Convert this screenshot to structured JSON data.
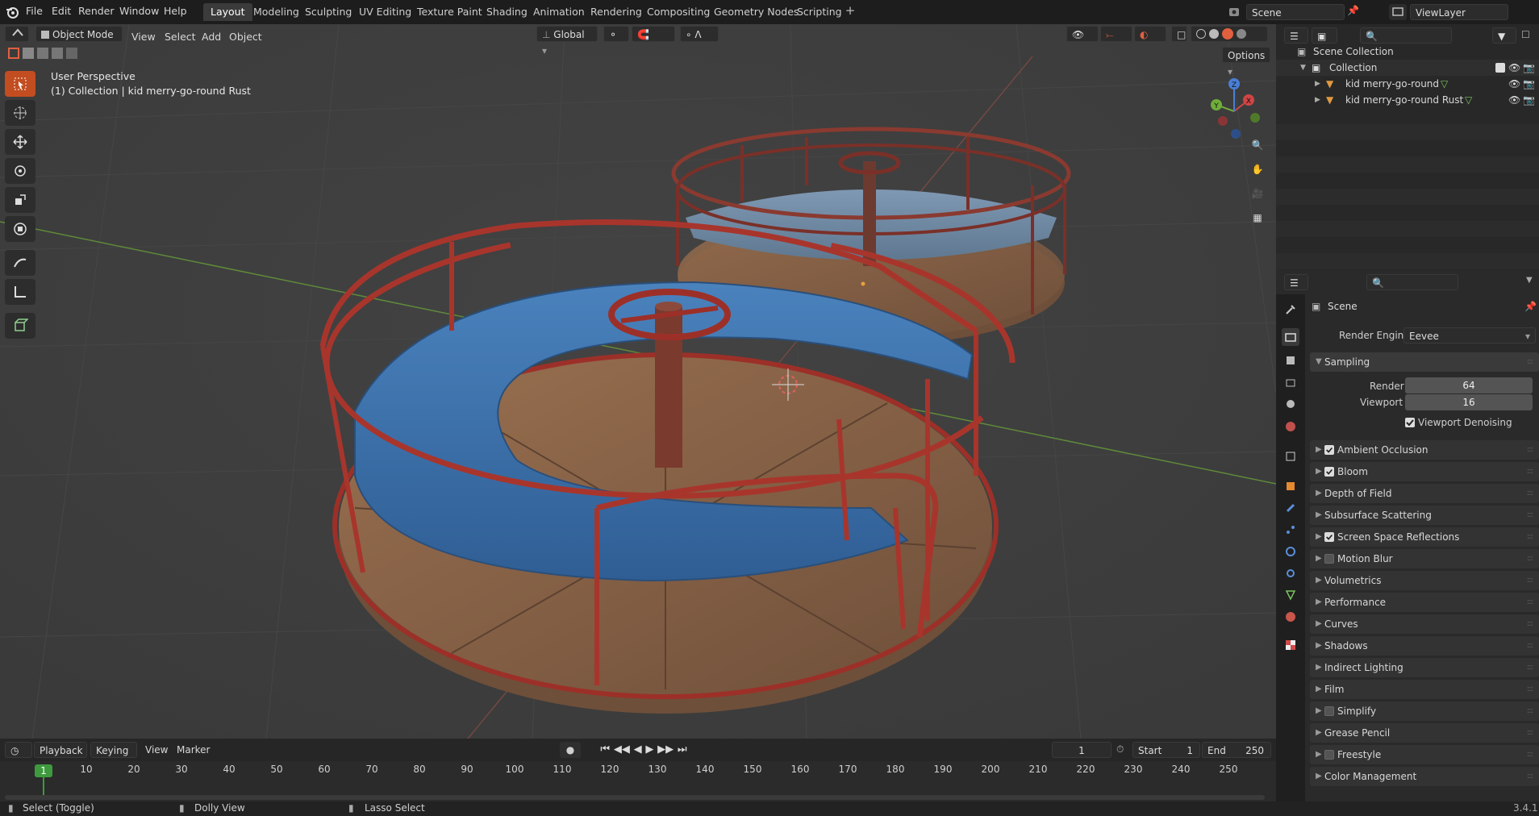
{
  "menus": [
    "File",
    "Edit",
    "Render",
    "Window",
    "Help"
  ],
  "workspaces": [
    "Layout",
    "Modeling",
    "Sculpting",
    "UV Editing",
    "Texture Paint",
    "Shading",
    "Animation",
    "Rendering",
    "Compositing",
    "Geometry Nodes",
    "Scripting"
  ],
  "active_workspace": "Layout",
  "scene_name": "Scene",
  "view_layer": "ViewLayer",
  "viewport": {
    "mode": "Object Mode",
    "menu": [
      "View",
      "Select",
      "Add",
      "Object"
    ],
    "orientation": "Global",
    "options_label": "Options",
    "overlay_line1": "User Perspective",
    "overlay_line2": "(1) Collection | kid merry-go-round Rust"
  },
  "tools": [
    "select-box-tool",
    "cursor-tool",
    "move-tool",
    "rotate-tool",
    "scale-tool",
    "transform-tool",
    "annotate-tool",
    "measure-tool",
    "add-cube-tool"
  ],
  "gizmo_axes": [
    "X",
    "Y",
    "Z"
  ],
  "outliner": {
    "root": "Scene Collection",
    "collection": "Collection",
    "objects": [
      "kid merry-go-round",
      "kid merry-go-round Rust"
    ]
  },
  "properties": {
    "title": "Scene",
    "render_engine_label": "Render Engine",
    "render_engine": "Eevee",
    "sampling_label": "Sampling",
    "render_label": "Render",
    "render_samples": "64",
    "viewport_label": "Viewport",
    "viewport_samples": "16",
    "denoise_label": "Viewport Denoising",
    "panels": [
      {
        "label": "Ambient Occlusion",
        "has_checkbox": true,
        "checked": true
      },
      {
        "label": "Bloom",
        "has_checkbox": true,
        "checked": true
      },
      {
        "label": "Depth of Field",
        "has_checkbox": false,
        "checked": false
      },
      {
        "label": "Subsurface Scattering",
        "has_checkbox": false,
        "checked": false
      },
      {
        "label": "Screen Space Reflections",
        "has_checkbox": true,
        "checked": true
      },
      {
        "label": "Motion Blur",
        "has_checkbox": true,
        "checked": false
      },
      {
        "label": "Volumetrics",
        "has_checkbox": false,
        "checked": false
      },
      {
        "label": "Performance",
        "has_checkbox": false,
        "checked": false
      },
      {
        "label": "Curves",
        "has_checkbox": false,
        "checked": false
      },
      {
        "label": "Shadows",
        "has_checkbox": false,
        "checked": false
      },
      {
        "label": "Indirect Lighting",
        "has_checkbox": false,
        "checked": false
      },
      {
        "label": "Film",
        "has_checkbox": false,
        "checked": false
      },
      {
        "label": "Simplify",
        "has_checkbox": true,
        "checked": false
      },
      {
        "label": "Grease Pencil",
        "has_checkbox": false,
        "checked": false
      },
      {
        "label": "Freestyle",
        "has_checkbox": true,
        "checked": false
      },
      {
        "label": "Color Management",
        "has_checkbox": false,
        "checked": false
      }
    ]
  },
  "timeline": {
    "menus": [
      "Playback",
      "Keying",
      "View",
      "Marker"
    ],
    "current_frame": "1",
    "start_label": "Start",
    "start": "1",
    "end_label": "End",
    "end": "250",
    "ticks": [
      "10",
      "20",
      "30",
      "40",
      "50",
      "60",
      "70",
      "80",
      "90",
      "100",
      "110",
      "120",
      "130",
      "140",
      "150",
      "160",
      "170",
      "180",
      "190",
      "200",
      "210",
      "220",
      "230",
      "240",
      "250"
    ]
  },
  "status": {
    "left": "Select (Toggle)",
    "middle": "Dolly View",
    "right": "Lasso Select",
    "version": "3.4.1"
  },
  "colors": {
    "accent": "#c24d20",
    "active_frame": "#3d9b3d",
    "seat_blue": "#3d6fa8",
    "rail_red": "#9c3028",
    "deck_wood": "#8a6448"
  }
}
